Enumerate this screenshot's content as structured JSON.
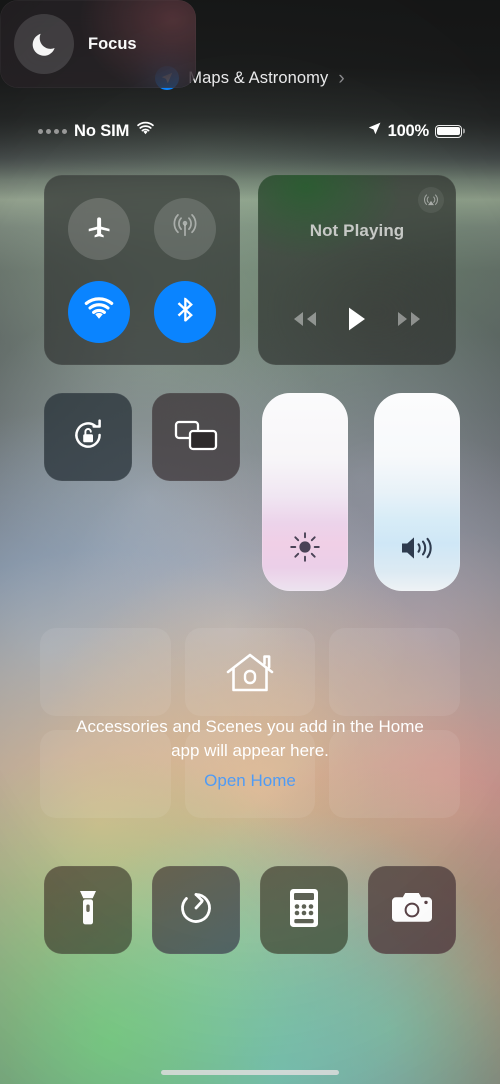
{
  "header": {
    "title": "Maps & Astronomy",
    "badge_icon": "location-arrow-icon",
    "chevron": "›",
    "accent_color": "#0a84ff"
  },
  "status_bar": {
    "signal_icon": "no-signal-dots-icon",
    "carrier": "No SIM",
    "wifi_icon": "wifi-icon",
    "location_icon": "location-arrow-icon",
    "battery_percent": "100%",
    "battery_icon": "battery-full-icon"
  },
  "connectivity": {
    "buttons": [
      {
        "name": "airplane-mode",
        "icon": "airplane-icon",
        "state": "off"
      },
      {
        "name": "cellular-data",
        "icon": "cellular-antenna-icon",
        "state": "unavailable"
      },
      {
        "name": "wifi",
        "icon": "wifi-icon",
        "state": "on"
      },
      {
        "name": "bluetooth",
        "icon": "bluetooth-icon",
        "state": "on"
      }
    ],
    "on_color": "#0a84ff"
  },
  "media": {
    "title": "Not Playing",
    "airplay_icon": "airplay-audio-icon",
    "controls": [
      {
        "name": "rewind",
        "icon": "rewind-icon"
      },
      {
        "name": "play",
        "icon": "play-icon"
      },
      {
        "name": "fast-forward",
        "icon": "fast-forward-icon"
      }
    ]
  },
  "tiles": {
    "rotation_lock": {
      "icon": "rotation-lock-icon",
      "state": "off"
    },
    "screen_mirroring": {
      "icon": "screen-mirroring-icon",
      "state": "off"
    }
  },
  "focus": {
    "label": "Focus",
    "icon": "crescent-moon-icon",
    "state": "off"
  },
  "sliders": [
    {
      "name": "brightness",
      "icon": "brightness-sun-icon",
      "value": 100
    },
    {
      "name": "volume",
      "icon": "volume-speaker-icon",
      "value": 100
    }
  ],
  "home": {
    "icon": "house-icon",
    "message": "Accessories and Scenes you add in the Home app will appear here.",
    "link": "Open Home",
    "link_color": "#4f9bf5"
  },
  "shortcuts": [
    {
      "name": "flashlight",
      "icon": "flashlight-icon"
    },
    {
      "name": "timer",
      "icon": "timer-icon"
    },
    {
      "name": "calculator",
      "icon": "calculator-icon"
    },
    {
      "name": "camera",
      "icon": "camera-icon"
    }
  ]
}
